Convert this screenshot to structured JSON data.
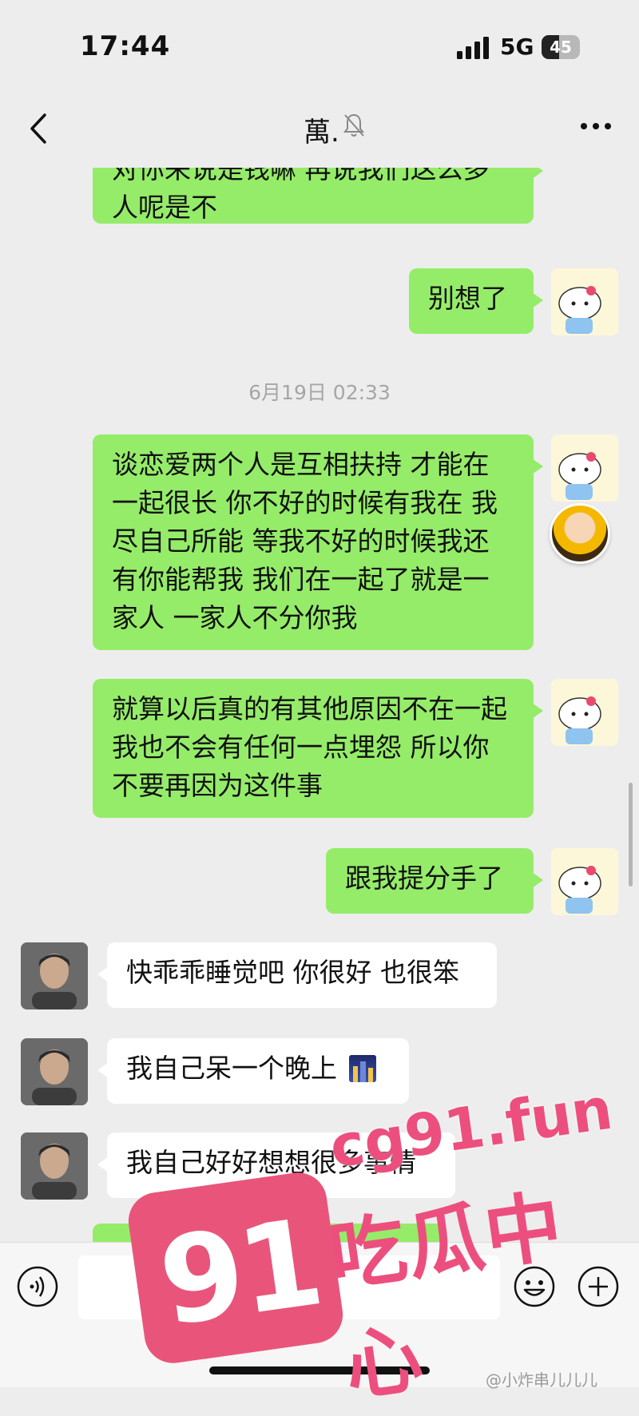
{
  "status_bar": {
    "time": "17:44",
    "network": "5G",
    "battery": "45"
  },
  "nav": {
    "title": "萬."
  },
  "messages": {
    "m1": "对你来说是钱嘛 再说我们这么多人呢是不",
    "m2": "别想了",
    "timestamp": "6月19日 02:33",
    "m3": "谈恋爱两个人是互相扶持 才能在一起很长 你不好的时候有我在 我尽自己所能 等我不好的时候我还有你能帮我 我们在一起了就是一家人 一家人不分你我",
    "m4": "就算以后真的有其他原因不在一起我也不会有任何一点埋怨 所以你不要再因为这件事",
    "m5": "跟我提分手了",
    "m6": "快乖乖睡觉吧 你很好 也很笨",
    "m7": "我自己呆一个晚上",
    "m8": "我自己好好想想很多事情"
  },
  "icons": {
    "back": "chevron-left-icon",
    "mute": "bell-muted-icon",
    "more": "more-dots-icon",
    "voice": "voice-input-icon",
    "emoji": "emoji-icon",
    "plus": "plus-icon"
  },
  "watermark": {
    "badge": "91",
    "domain": "cg91.fun",
    "center": "吃瓜中心",
    "weibo": "@小炸串儿儿儿"
  },
  "colors": {
    "my_bubble": "#95ec69",
    "their_bubble": "#ffffff",
    "background": "#ededed",
    "watermark": "#ec4f7e"
  }
}
